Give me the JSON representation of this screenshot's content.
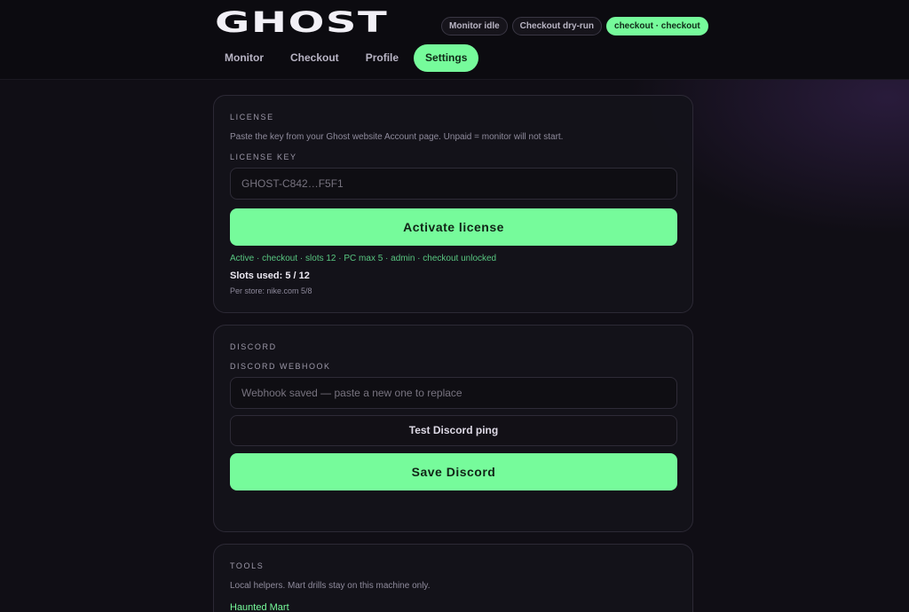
{
  "app": {
    "logo": "GHOST"
  },
  "status_pills": [
    {
      "label": "Monitor idle",
      "active": false
    },
    {
      "label": "Checkout dry-run",
      "active": false
    },
    {
      "label": "checkout · checkout",
      "active": true
    }
  ],
  "nav": {
    "tabs": [
      {
        "label": "Monitor",
        "active": false
      },
      {
        "label": "Checkout",
        "active": false
      },
      {
        "label": "Profile",
        "active": false
      },
      {
        "label": "Settings",
        "active": true
      }
    ]
  },
  "license": {
    "title": "LICENSE",
    "hint": "Paste the key from your Ghost website Account page. Unpaid = monitor will not start.",
    "key_label": "LICENSE KEY",
    "key_value": "GHOST-C842…F5F1",
    "activate_label": "Activate license",
    "status": "Active · checkout · slots 12 · PC max 5 · admin · checkout unlocked",
    "slots_used": "Slots used: 5 / 12",
    "per_store": "Per store: nike.com 5/8"
  },
  "discord": {
    "title": "DISCORD",
    "webhook_label": "DISCORD WEBHOOK",
    "webhook_placeholder": "Webhook saved — paste a new one to replace",
    "test_label": "Test Discord ping",
    "save_label": "Save Discord"
  },
  "tools": {
    "title": "TOOLS",
    "hint": "Local helpers. Mart drills stay on this machine only.",
    "link_label": "Haunted Mart"
  },
  "colors": {
    "accent": "#76fb9b",
    "background": "#100e15",
    "card": "#14121a"
  }
}
